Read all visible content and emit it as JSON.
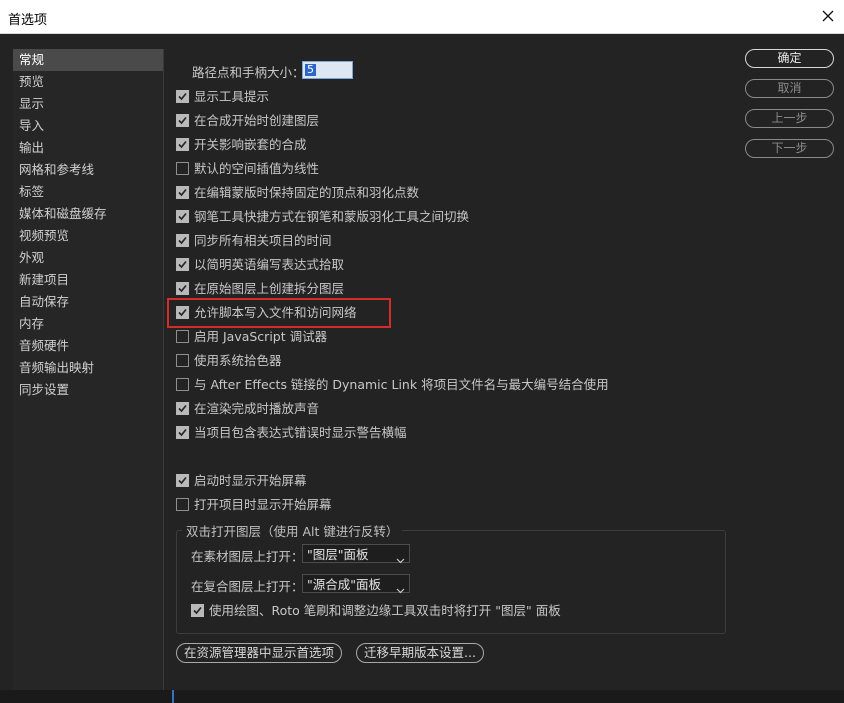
{
  "window": {
    "title": "首选项"
  },
  "sidebar": {
    "items": [
      {
        "label": "常规",
        "selected": true
      },
      {
        "label": "预览"
      },
      {
        "label": "显示"
      },
      {
        "label": "导入"
      },
      {
        "label": "输出"
      },
      {
        "label": "网格和参考线"
      },
      {
        "label": "标签"
      },
      {
        "label": "媒体和磁盘缓存"
      },
      {
        "label": "视频预览"
      },
      {
        "label": "外观"
      },
      {
        "label": "新建项目"
      },
      {
        "label": "自动保存"
      },
      {
        "label": "内存"
      },
      {
        "label": "音频硬件"
      },
      {
        "label": "音频输出映射"
      },
      {
        "label": "同步设置"
      }
    ]
  },
  "general": {
    "path_point_label": "路径点和手柄大小：",
    "path_point_value": "5",
    "checkboxes": [
      {
        "label": "显示工具提示",
        "checked": true
      },
      {
        "label": "在合成开始时创建图层",
        "checked": true
      },
      {
        "label": "开关影响嵌套的合成",
        "checked": true
      },
      {
        "label": "默认的空间插值为线性",
        "checked": false
      },
      {
        "label": "在编辑蒙版时保持固定的顶点和羽化点数",
        "checked": true
      },
      {
        "label": "钢笔工具快捷方式在钢笔和蒙版羽化工具之间切换",
        "checked": true
      },
      {
        "label": "同步所有相关项目的时间",
        "checked": true
      },
      {
        "label": "以简明英语编写表达式拾取",
        "checked": true
      },
      {
        "label": "在原始图层上创建拆分图层",
        "checked": true
      },
      {
        "label": "允许脚本写入文件和访问网络",
        "checked": true
      },
      {
        "label": "启用 JavaScript 调试器",
        "checked": false
      },
      {
        "label": "使用系统拾色器",
        "checked": false
      },
      {
        "label": "与 After Effects 链接的 Dynamic Link 将项目文件名与最大编号结合使用",
        "checked": false
      },
      {
        "label": "在渲染完成时播放声音",
        "checked": true
      },
      {
        "label": "当项目包含表达式错误时显示警告横幅",
        "checked": true
      }
    ],
    "start_checkboxes": [
      {
        "label": "启动时显示开始屏幕",
        "checked": true
      },
      {
        "label": "打开项目时显示开始屏幕",
        "checked": false
      }
    ],
    "doubleclick": {
      "legend": "双击打开图层（使用 Alt 键进行反转）",
      "footage_label": "在素材图层上打开：",
      "footage_value": "\"图层\"面板",
      "comp_label": "在复合图层上打开：",
      "comp_value": "\"源合成\"面板",
      "roto_label": "使用绘图、Roto 笔刷和调整边缘工具双击时将打开 \"图层\" 面板",
      "roto_checked": true
    },
    "reveal_button": "在资源管理器中显示首选项",
    "migrate_button": "迁移早期版本设置..."
  },
  "buttons": {
    "ok": "确定",
    "cancel": "取消",
    "prev": "上一步",
    "next": "下一步"
  },
  "colors": {
    "background": "#232323",
    "highlight_box": "#d42b2b",
    "selected_item": "#4a4a4a"
  }
}
